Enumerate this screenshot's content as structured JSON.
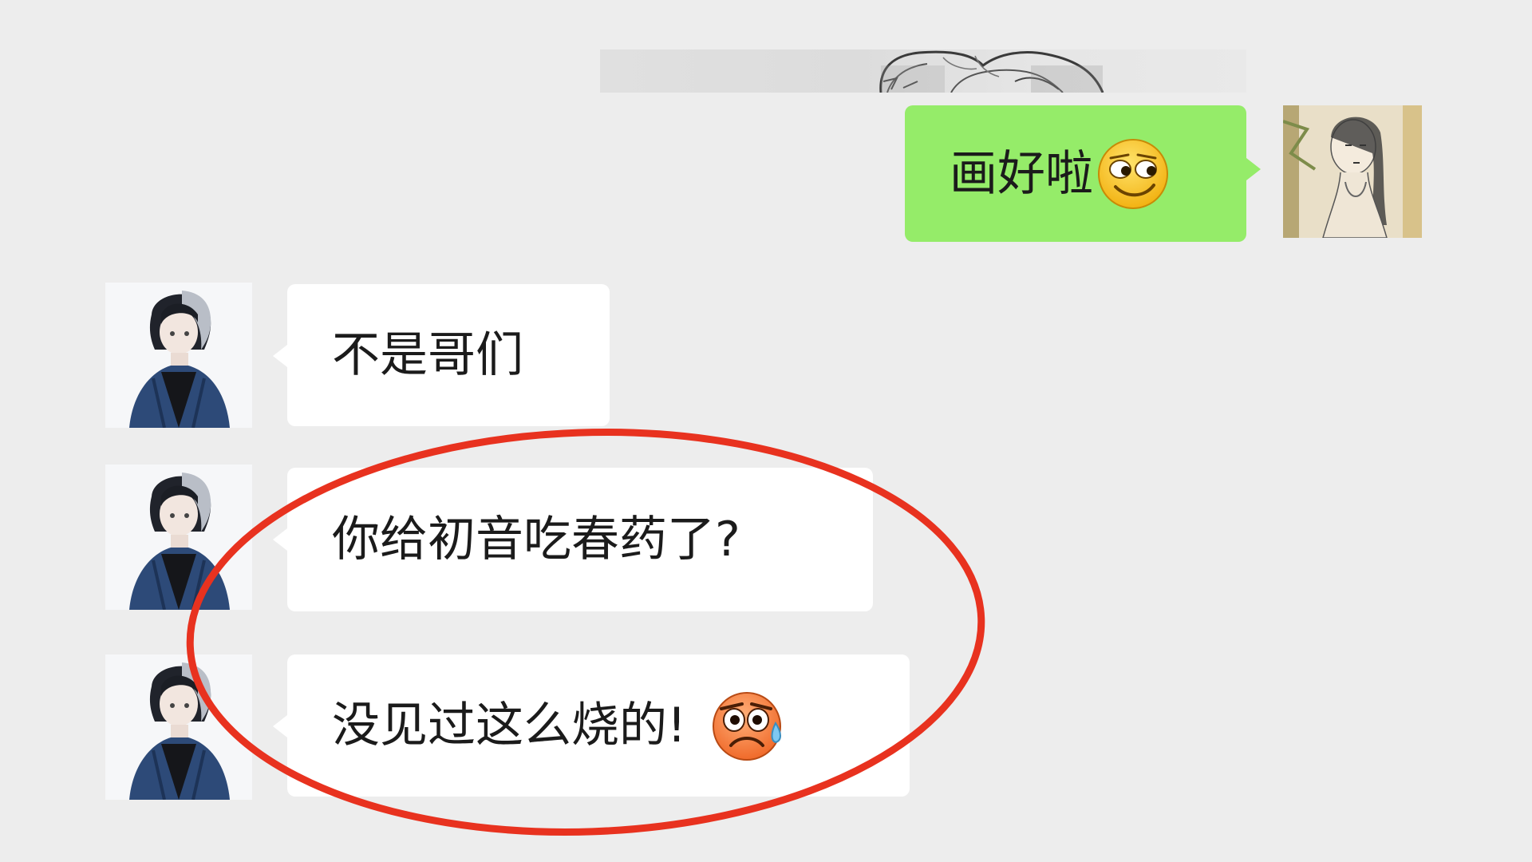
{
  "chat": {
    "messages": [
      {
        "sender": "me",
        "type": "image",
        "description": "pencil-sketch"
      },
      {
        "sender": "me",
        "type": "text",
        "text": "画好啦",
        "emoji": "smirk-emoji"
      },
      {
        "sender": "other",
        "type": "text",
        "text": "不是哥们"
      },
      {
        "sender": "other",
        "type": "text",
        "text": "你给初音吃春药了?"
      },
      {
        "sender": "other",
        "type": "text",
        "text": "没见过这么烧的!",
        "emoji": "awkward-sweat-emoji"
      }
    ]
  },
  "colors": {
    "background": "#ededed",
    "bubble_me": "#95ec69",
    "bubble_other": "#ffffff",
    "annotation": "#e8321f"
  },
  "annotation": {
    "shape": "ellipse",
    "color": "#e8321f"
  }
}
